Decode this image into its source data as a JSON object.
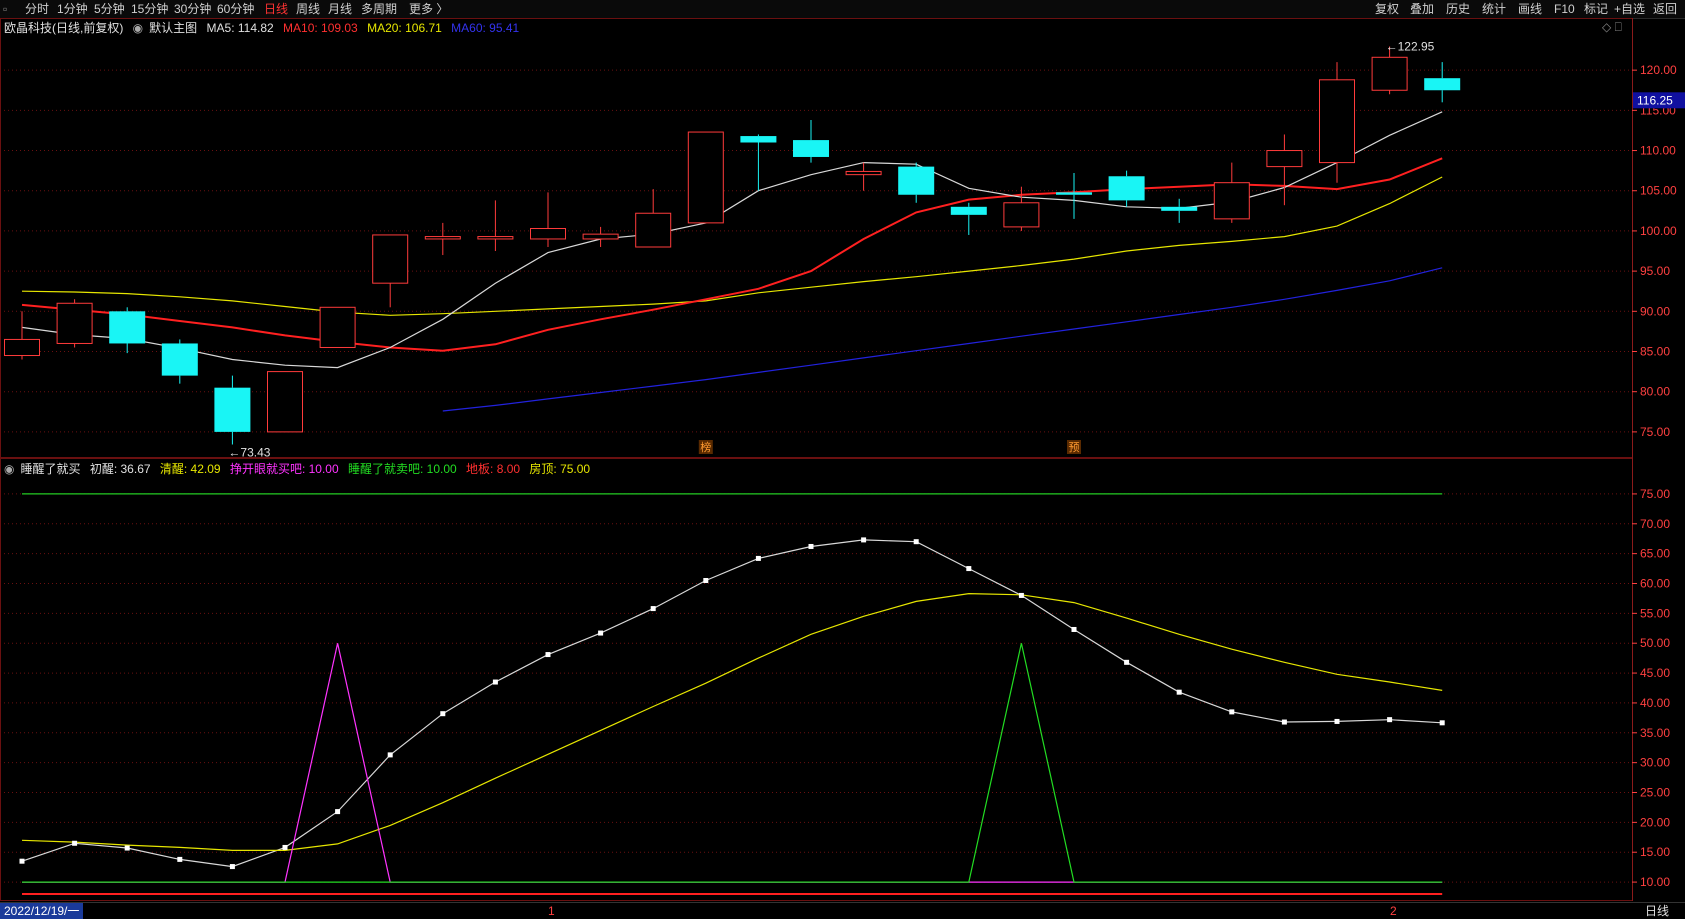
{
  "toolbar": {
    "left": [
      "分时",
      "1分钟",
      "5分钟",
      "15分钟",
      "30分钟",
      "60分钟",
      "日线",
      "周线",
      "月线",
      "多周期",
      "更多 〉"
    ],
    "active": "日线",
    "right": [
      "复权",
      "叠加",
      "历史",
      "统计",
      "画线",
      "F10",
      "标记",
      "+自选",
      "返回"
    ]
  },
  "main_header": {
    "stock": "欧晶科技(日线,前复权)",
    "template": "默认主图",
    "ma5": "MA5: 114.82",
    "ma10": "MA10: 109.03",
    "ma20": "MA20: 106.71",
    "ma60": "MA60: 95.41"
  },
  "sub_header": {
    "name": "睡醒了就买",
    "items": [
      "初醒: 36.67",
      "清醒: 42.09",
      "挣开眼就买吧: 10.00",
      "睡醒了就卖吧: 10.00",
      "地板: 8.00",
      "房顶: 75.00"
    ]
  },
  "colors": {
    "up": "#ff3b3b",
    "down": "#19f5f5",
    "ma5": "#d8d8d8",
    "ma10": "#ff2020",
    "ma20": "#e6e600",
    "ma60": "#2222dd",
    "buy": "#ff33ff",
    "sell": "#22dd22",
    "floor": "#ff2020",
    "roof": "#22cc22",
    "grid": "#6a1010",
    "axis": "#ff4040"
  },
  "status": {
    "date": "2022/12/19/一",
    "m1": "1",
    "m2": "2",
    "period": "日线"
  },
  "chart_data": [
    {
      "type": "candlestick",
      "ylim": [
        72,
        124
      ],
      "yticks": [
        75,
        80,
        85,
        90,
        95,
        100,
        105,
        110,
        115,
        120
      ],
      "current_price": "116.25",
      "high_label": "122.95",
      "low_label": "73.43",
      "markers": [
        {
          "index": 13,
          "text": "榜"
        },
        {
          "index": 20,
          "text": "预"
        }
      ],
      "candles": [
        {
          "o": 84.5,
          "c": 86.5,
          "h": 90.0,
          "l": 84.0
        },
        {
          "o": 86.0,
          "c": 91.0,
          "h": 91.5,
          "l": 85.5
        },
        {
          "o": 90.0,
          "c": 86.0,
          "h": 90.5,
          "l": 84.8
        },
        {
          "o": 86.0,
          "c": 82.0,
          "h": 86.5,
          "l": 81.0
        },
        {
          "o": 80.5,
          "c": 75.0,
          "h": 82.0,
          "l": 73.43
        },
        {
          "o": 75.0,
          "c": 82.5,
          "h": 82.5,
          "l": 75.0
        },
        {
          "o": 85.5,
          "c": 90.5,
          "h": 90.5,
          "l": 85.5
        },
        {
          "o": 93.5,
          "c": 99.5,
          "h": 99.5,
          "l": 90.5
        },
        {
          "o": 99.0,
          "c": 99.3,
          "h": 101.0,
          "l": 97.0
        },
        {
          "o": 99.0,
          "c": 99.3,
          "h": 103.8,
          "l": 97.5
        },
        {
          "o": 99.0,
          "c": 100.3,
          "h": 104.8,
          "l": 98.0
        },
        {
          "o": 99.0,
          "c": 99.6,
          "h": 100.5,
          "l": 98.0
        },
        {
          "o": 98.0,
          "c": 102.2,
          "h": 105.2,
          "l": 98.0
        },
        {
          "o": 101.0,
          "c": 112.3,
          "h": 112.3,
          "l": 101.0
        },
        {
          "o": 111.8,
          "c": 111.0,
          "h": 112.0,
          "l": 105.0
        },
        {
          "o": 111.3,
          "c": 109.2,
          "h": 113.8,
          "l": 108.5
        },
        {
          "o": 107.0,
          "c": 107.4,
          "h": 108.5,
          "l": 105.0
        },
        {
          "o": 108.0,
          "c": 104.5,
          "h": 108.5,
          "l": 103.5
        },
        {
          "o": 103.0,
          "c": 102.0,
          "h": 103.5,
          "l": 99.5
        },
        {
          "o": 100.5,
          "c": 103.5,
          "h": 105.5,
          "l": 100.0
        },
        {
          "o": 104.8,
          "c": 104.5,
          "h": 107.2,
          "l": 101.5
        },
        {
          "o": 106.8,
          "c": 103.8,
          "h": 107.5,
          "l": 103.0
        },
        {
          "o": 103.0,
          "c": 102.5,
          "h": 104.0,
          "l": 101.0
        },
        {
          "o": 101.5,
          "c": 106.0,
          "h": 108.5,
          "l": 101.0
        },
        {
          "o": 108.0,
          "c": 110.0,
          "h": 112.0,
          "l": 103.2
        },
        {
          "o": 108.5,
          "c": 118.8,
          "h": 121.0,
          "l": 106.0
        },
        {
          "o": 117.5,
          "c": 121.6,
          "h": 122.95,
          "l": 117.0
        },
        {
          "o": 119.0,
          "c": 117.5,
          "h": 121.0,
          "l": 116.0
        }
      ],
      "ma5": [
        88.0,
        87.1,
        86.6,
        85.4,
        84.0,
        83.3,
        83.0,
        85.5,
        89.0,
        93.5,
        97.3,
        99.0,
        99.6,
        101.0,
        105.0,
        107.0,
        108.5,
        108.3,
        105.3,
        104.2,
        103.8,
        103.0,
        102.8,
        103.6,
        105.4,
        108.5,
        111.9,
        114.82
      ],
      "ma10": [
        90.8,
        90.2,
        89.6,
        88.8,
        88.0,
        87.0,
        86.2,
        85.5,
        85.1,
        85.9,
        87.7,
        89.0,
        90.2,
        91.5,
        92.8,
        95.0,
        99.0,
        102.3,
        103.9,
        104.5,
        104.8,
        105.2,
        105.5,
        105.8,
        105.6,
        105.2,
        106.4,
        109.03
      ],
      "ma20": [
        92.5,
        92.4,
        92.2,
        91.8,
        91.3,
        90.6,
        89.9,
        89.5,
        89.7,
        90.0,
        90.3,
        90.6,
        90.9,
        91.3,
        92.3,
        93.0,
        93.7,
        94.3,
        95.0,
        95.7,
        96.5,
        97.5,
        98.2,
        98.7,
        99.3,
        100.6,
        103.4,
        106.71
      ],
      "ma60": [
        null,
        null,
        null,
        null,
        null,
        null,
        null,
        null,
        77.6,
        78.3,
        79.1,
        79.9,
        80.7,
        81.5,
        82.4,
        83.3,
        84.2,
        85.1,
        86.0,
        86.9,
        87.8,
        88.7,
        89.6,
        90.5,
        91.5,
        92.6,
        93.8,
        95.41
      ]
    },
    {
      "type": "line",
      "ylim": [
        7,
        78
      ],
      "yticks": [
        10,
        15,
        20,
        25,
        30,
        35,
        40,
        45,
        50,
        55,
        60,
        65,
        70,
        75
      ],
      "series": [
        {
          "name": "初醒",
          "values": [
            13.5,
            16.5,
            15.7,
            13.8,
            12.6,
            15.8,
            21.8,
            31.3,
            38.2,
            43.5,
            48.1,
            51.7,
            55.8,
            60.5,
            64.2,
            66.2,
            67.3,
            67.0,
            62.5,
            58.0,
            52.3,
            46.8,
            41.8,
            38.5,
            36.8,
            36.9,
            37.2,
            36.67
          ]
        },
        {
          "name": "清醒",
          "values": [
            17.0,
            16.7,
            16.2,
            15.8,
            15.3,
            15.3,
            16.4,
            19.5,
            23.3,
            27.4,
            31.4,
            35.4,
            39.4,
            43.3,
            47.5,
            51.5,
            54.5,
            57.0,
            58.3,
            58.1,
            56.8,
            54.2,
            51.5,
            49.0,
            46.8,
            44.8,
            43.5,
            42.09
          ]
        },
        {
          "name": "挣开眼就买吧",
          "values": [
            10,
            10,
            10,
            10,
            10,
            10,
            50,
            10,
            10,
            10,
            10,
            10,
            10,
            10,
            10,
            10,
            10,
            10,
            10,
            10,
            10,
            10,
            10,
            10,
            10,
            10,
            10,
            10
          ]
        },
        {
          "name": "睡醒了就卖吧",
          "values": [
            10,
            10,
            10,
            10,
            10,
            10,
            10,
            10,
            10,
            10,
            10,
            10,
            10,
            10,
            10,
            10,
            10,
            10,
            10,
            50,
            10,
            10,
            10,
            10,
            10,
            10,
            10,
            10
          ]
        },
        {
          "name": "地板",
          "values": [
            8,
            8,
            8,
            8,
            8,
            8,
            8,
            8,
            8,
            8,
            8,
            8,
            8,
            8,
            8,
            8,
            8,
            8,
            8,
            8,
            8,
            8,
            8,
            8,
            8,
            8,
            8,
            8
          ]
        },
        {
          "name": "房顶",
          "values": [
            75,
            75,
            75,
            75,
            75,
            75,
            75,
            75,
            75,
            75,
            75,
            75,
            75,
            75,
            75,
            75,
            75,
            75,
            75,
            75,
            75,
            75,
            75,
            75,
            75,
            75,
            75,
            75
          ]
        }
      ]
    }
  ]
}
